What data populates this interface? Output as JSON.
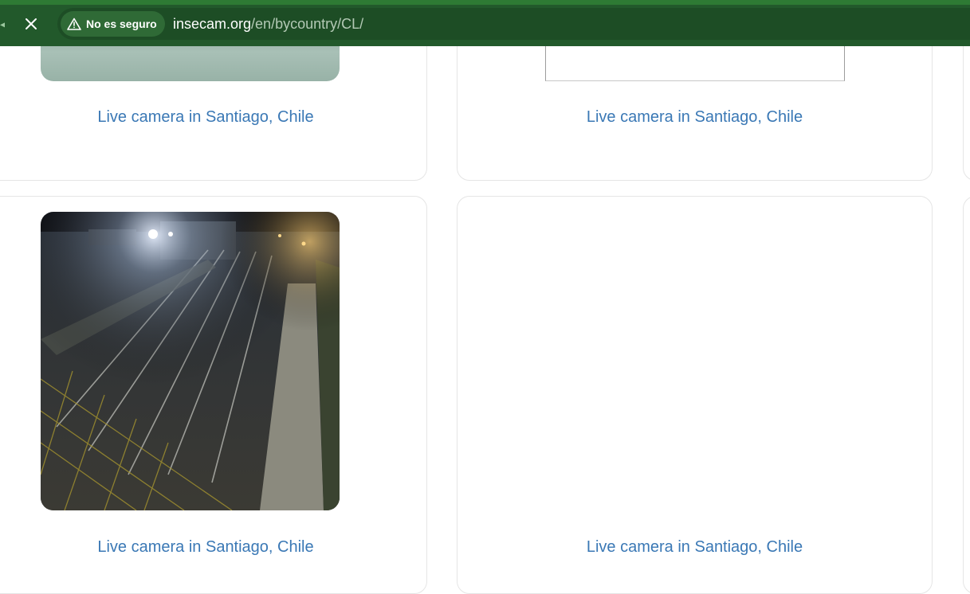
{
  "browser": {
    "security_label": "No es seguro",
    "url_host": "insecam.org",
    "url_path": "/en/bycountry/CL/",
    "close_icon": "close-icon",
    "warning_icon": "warning-triangle-icon"
  },
  "colors": {
    "toolbar": "#22592b",
    "link": "#3a78b5",
    "card_border": "#e5e5e5"
  },
  "cards": [
    {
      "title": "Live camera in Santiago, Chile"
    },
    {
      "title": "Live camera in Santiago, Chile"
    },
    {
      "title": "Live camera in Santiago, Chile"
    },
    {
      "title": "Live camera in Santiago, Chile"
    }
  ]
}
